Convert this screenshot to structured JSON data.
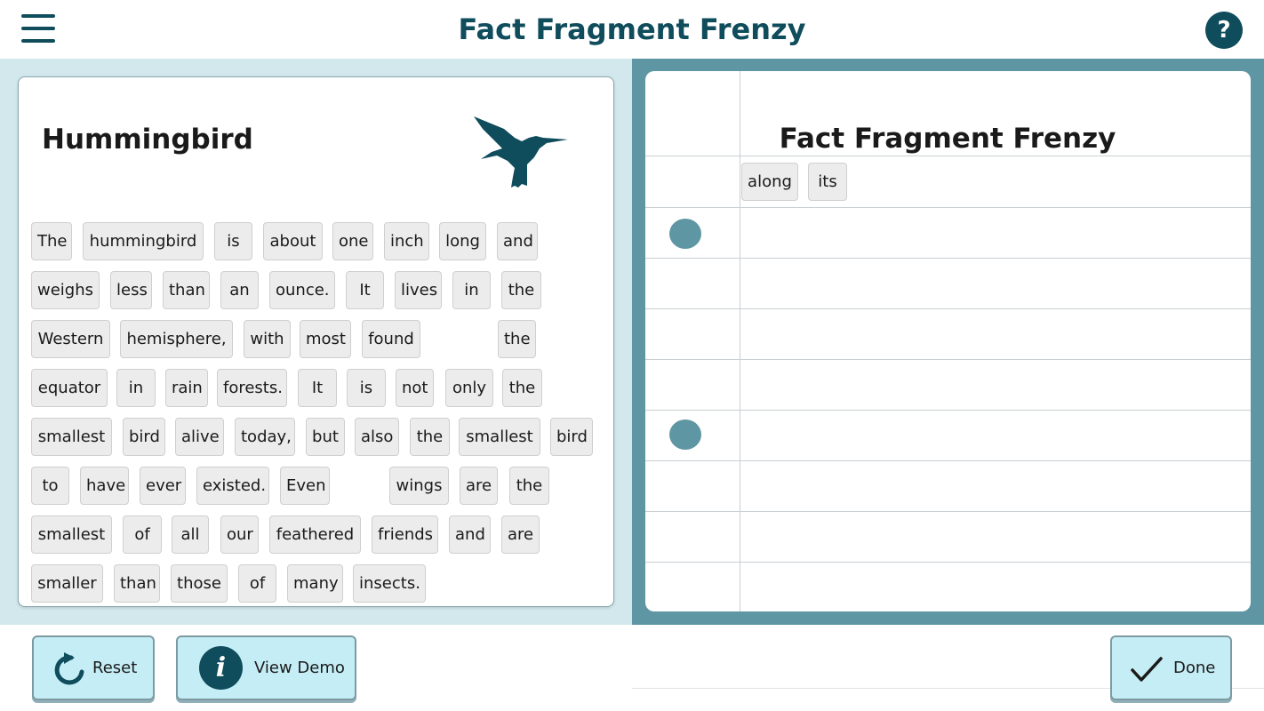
{
  "header": {
    "title": "Fact Fragment Frenzy",
    "menu_icon": "hamburger-menu-icon",
    "help_label": "?"
  },
  "text_card": {
    "title": "Hummingbird",
    "icon": "hummingbird-icon",
    "rows": [
      [
        "The",
        "hummingbird",
        "is",
        "about",
        "one",
        "inch",
        "long",
        "and"
      ],
      [
        "weighs",
        "less",
        "than",
        "an",
        "ounce.",
        "It",
        "lives",
        "in",
        "the"
      ],
      [
        "Western",
        "hemisphere,",
        "with",
        "most",
        "found",
        "the"
      ],
      [
        "equator",
        "in",
        "rain",
        "forests.",
        "It",
        "is",
        "not",
        "only",
        "the"
      ],
      [
        "smallest",
        "bird",
        "alive",
        "today,",
        "but",
        "also",
        "the",
        "smallest",
        "bird"
      ],
      [
        "to",
        "have",
        "ever",
        "existed.",
        "Even",
        "wings",
        "are",
        "the"
      ],
      [
        "smallest",
        "of",
        "all",
        "our",
        "feathered",
        "friends",
        "and",
        "are"
      ],
      [
        "smaller",
        "than",
        "those",
        "of",
        "many",
        "insects."
      ]
    ]
  },
  "notebook": {
    "title": "Fact Fragment Frenzy",
    "placed_words": [
      "along",
      "its"
    ],
    "bullet_rows": 2
  },
  "buttons": {
    "reset_label": "Reset",
    "reset_icon": "refresh-icon",
    "demo_label": "View Demo",
    "demo_icon": "info-icon",
    "info_glyph": "i",
    "done_label": "Done",
    "done_icon": "checkmark-icon"
  },
  "colors": {
    "accent": "#0f4c5c",
    "left_panel_bg": "#d3e8ec",
    "right_panel_bg": "#5e96a3",
    "button_bg": "#c5edf6",
    "chip_bg": "#ececec"
  }
}
